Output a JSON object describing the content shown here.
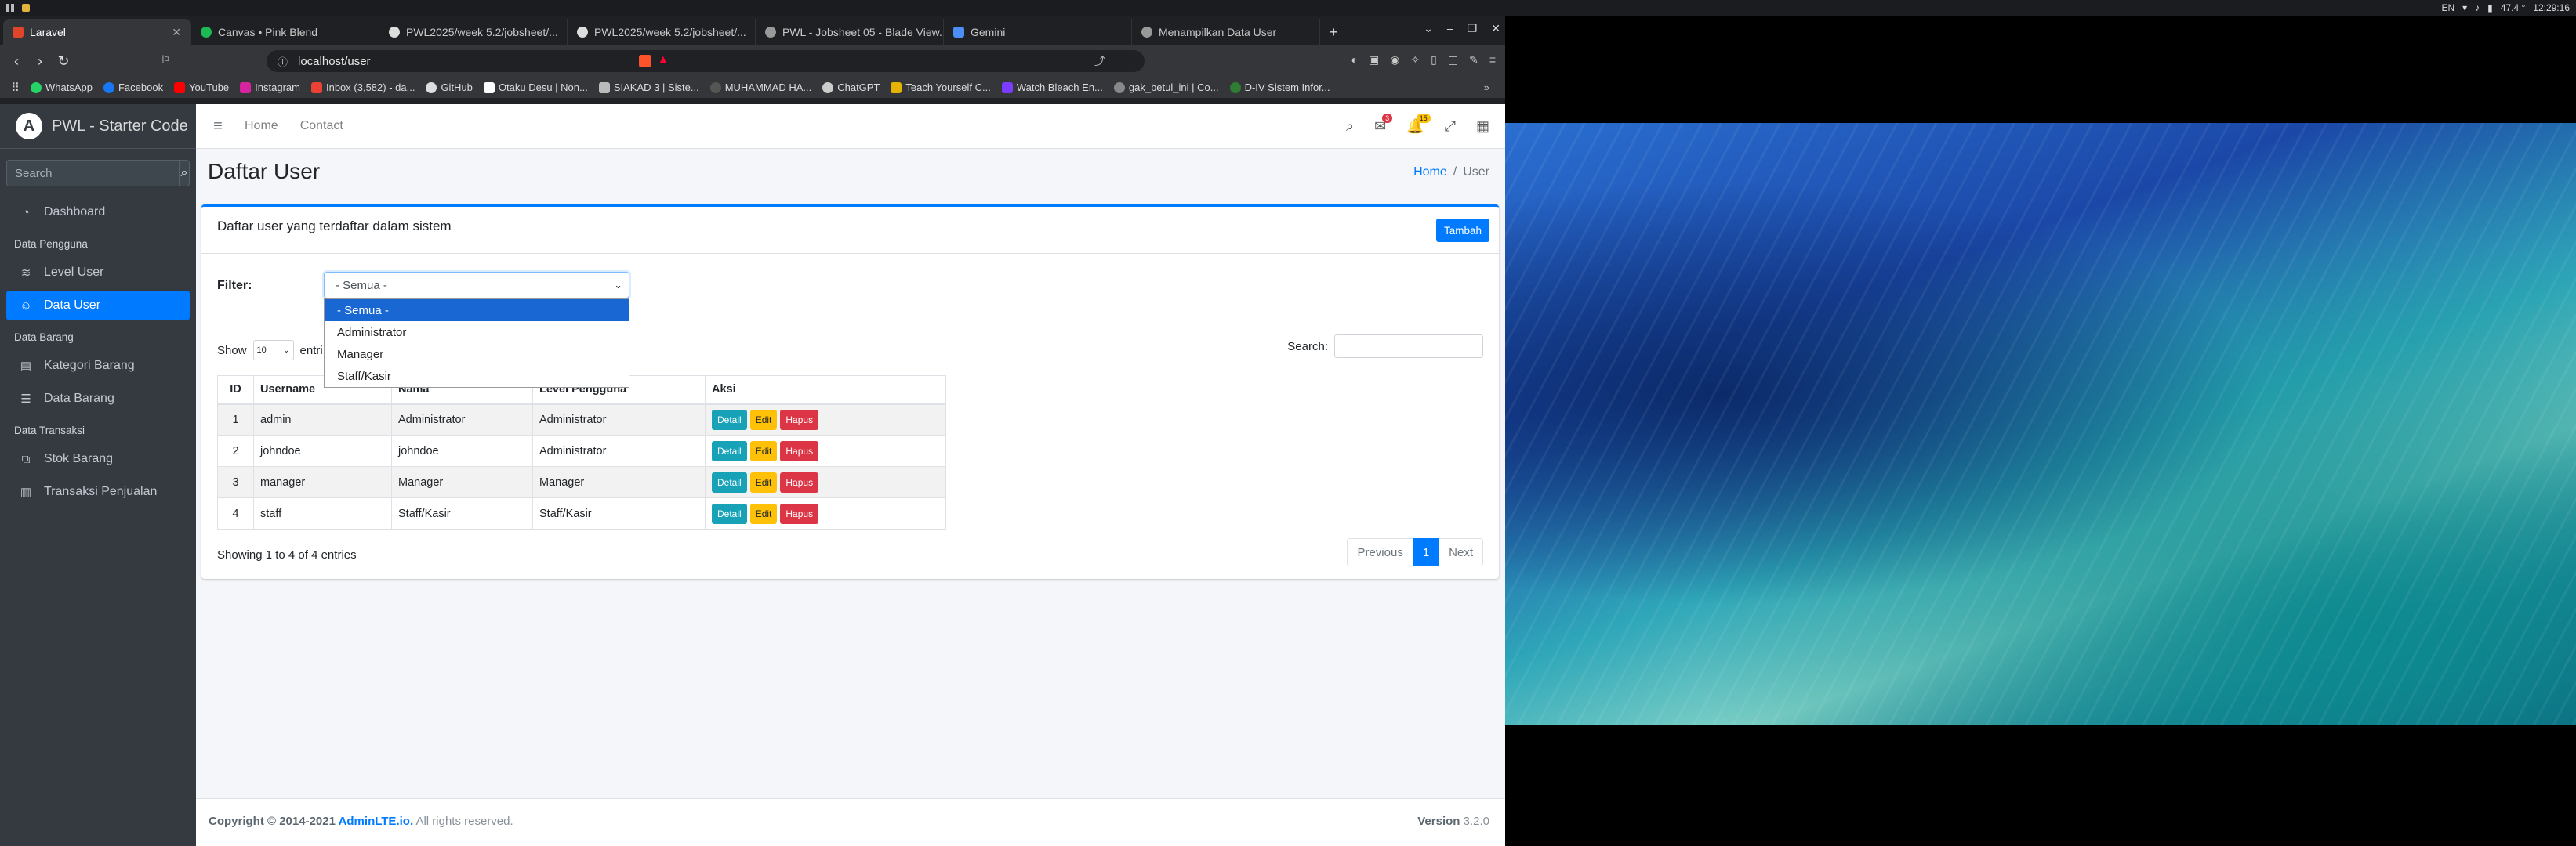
{
  "os": {
    "clock": "12:29:16",
    "temp": "47.4 °",
    "lang": "EN"
  },
  "browser": {
    "tabs": [
      {
        "title": "Laravel",
        "active": true
      },
      {
        "title": "Canvas • Pink Blend",
        "active": false
      },
      {
        "title": "PWL2025/week 5.2/jobsheet/...",
        "active": false
      },
      {
        "title": "PWL2025/week 5.2/jobsheet/...",
        "active": false
      },
      {
        "title": "PWL - Jobsheet 05 - Blade View...",
        "active": false
      },
      {
        "title": "Gemini",
        "active": false
      },
      {
        "title": "Menampilkan Data User",
        "active": false
      }
    ],
    "url": "localhost/user",
    "bookmarks": [
      "WhatsApp",
      "Facebook",
      "YouTube",
      "Instagram",
      "Inbox (3,582) - da...",
      "GitHub",
      "Otaku Desu | Non...",
      "SIAKAD 3 | Siste...",
      "MUHAMMAD HA...",
      "ChatGPT",
      "Teach Yourself C...",
      "Watch Bleach En...",
      "gak_betul_ini | Co...",
      "D-IV Sistem Infor..."
    ]
  },
  "app": {
    "brand": "PWL - Starter Code",
    "brand_letter": "A",
    "search_placeholder": "Search",
    "nav": {
      "dashboard": "Dashboard",
      "hdr_pengguna": "Data Pengguna",
      "level_user": "Level User",
      "data_user": "Data User",
      "hdr_barang": "Data Barang",
      "kategori_barang": "Kategori Barang",
      "data_barang": "Data Barang",
      "hdr_transaksi": "Data Transaksi",
      "stok_barang": "Stok Barang",
      "transaksi_penjualan": "Transaksi Penjualan"
    },
    "topnav": {
      "home": "Home",
      "contact": "Contact",
      "msg_badge": "3",
      "notif_badge": "15"
    },
    "page_title": "Daftar User",
    "breadcrumb": {
      "home": "Home",
      "current": "User"
    },
    "card": {
      "title": "Daftar user yang terdaftar dalam sistem",
      "add_button": "Tambah",
      "filter_label": "Filter:",
      "filter_value": "- Semua -",
      "filter_options": [
        "- Semua -",
        "Administrator",
        "Manager",
        "Staff/Kasir"
      ],
      "show_label": "Show",
      "show_value": "10",
      "entries_label": "entri",
      "search_label": "Search:",
      "columns": [
        "ID",
        "Username",
        "Nama",
        "Level Pengguna",
        "Aksi"
      ],
      "rows": [
        {
          "id": "1",
          "username": "admin",
          "nama": "Administrator",
          "level": "Administrator"
        },
        {
          "id": "2",
          "username": "johndoe",
          "nama": "johndoe",
          "level": "Administrator"
        },
        {
          "id": "3",
          "username": "manager",
          "nama": "Manager",
          "level": "Manager"
        },
        {
          "id": "4",
          "username": "staff",
          "nama": "Staff/Kasir",
          "level": "Staff/Kasir"
        }
      ],
      "btn_detail": "Detail",
      "btn_edit": "Edit",
      "btn_hapus": "Hapus",
      "info": "Showing 1 to 4 of 4 entries",
      "pager": {
        "prev": "Previous",
        "page": "1",
        "next": "Next"
      }
    },
    "footer": {
      "copy_prefix": "Copyright © 2014-2021 ",
      "copy_link": "AdminLTE.io.",
      "copy_suffix": " All rights reserved.",
      "version_label": "Version",
      "version": "3.2.0"
    }
  },
  "colors": {
    "primary": "#007bff",
    "sidebar": "#343a40",
    "info": "#17a2b8",
    "warning": "#ffc107",
    "danger": "#dc3545"
  }
}
